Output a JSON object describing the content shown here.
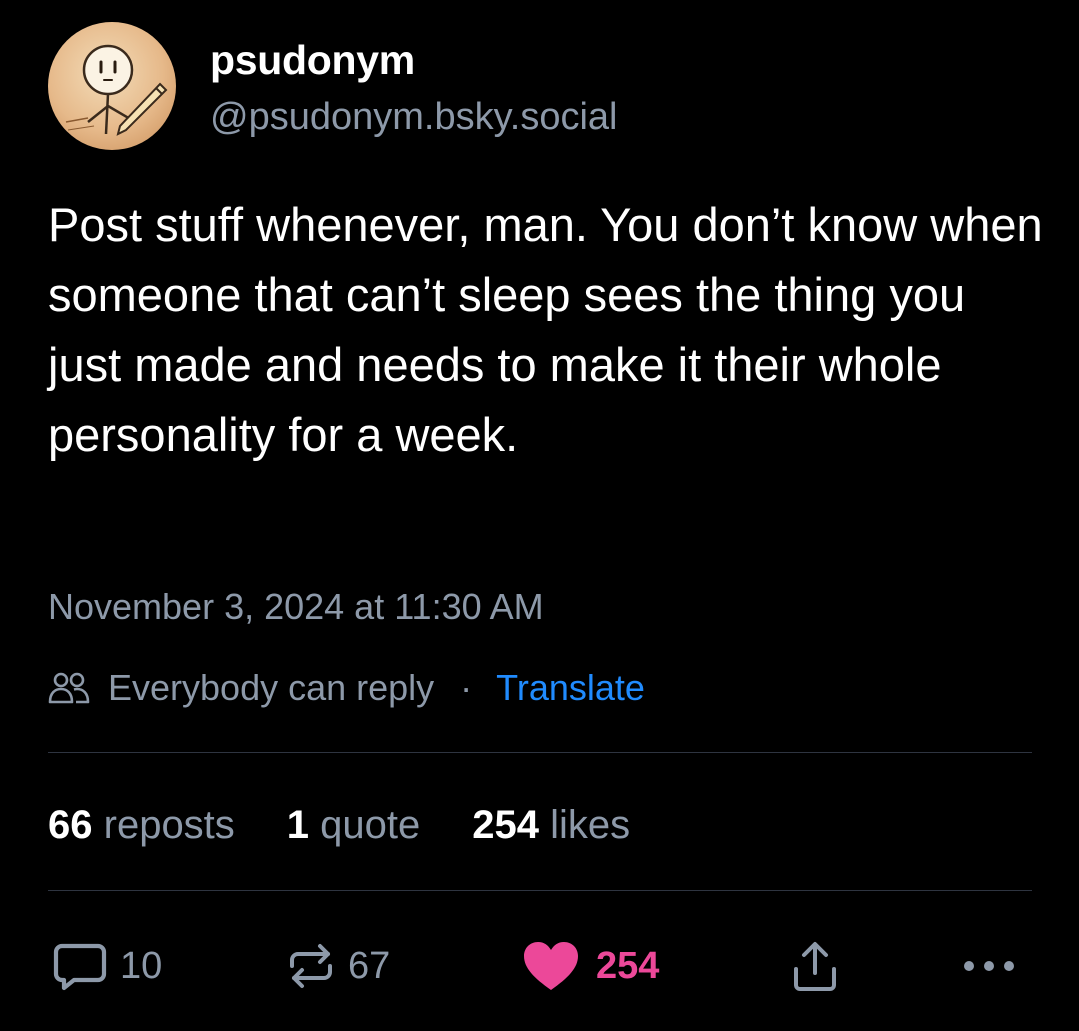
{
  "author": {
    "display_name": "psudonym",
    "handle": "@psudonym.bsky.social",
    "avatar_icon": "pencil-character-avatar"
  },
  "post": {
    "text": "Post stuff whenever, man. You don’t know when someone that can’t sleep sees the thing you just made and needs to make it their whole personality for a week.",
    "timestamp": "November 3, 2024 at 11:30 AM"
  },
  "reply_settings": {
    "icon": "people-icon",
    "label": "Everybody can reply",
    "separator": "·",
    "translate_label": "Translate"
  },
  "stats": {
    "reposts_count": "66",
    "reposts_label": "reposts",
    "quotes_count": "1",
    "quotes_label": "quote",
    "likes_count": "254",
    "likes_label": "likes"
  },
  "actions": {
    "reply_count": "10",
    "repost_count": "67",
    "like_count": "254",
    "share_icon": "share-icon",
    "more_icon": "more-icon"
  },
  "colors": {
    "background": "#000000",
    "text_primary": "#ffffff",
    "text_secondary": "#8d99a9",
    "link": "#208bfe",
    "like": "#ec4899",
    "divider": "#2e3440"
  }
}
